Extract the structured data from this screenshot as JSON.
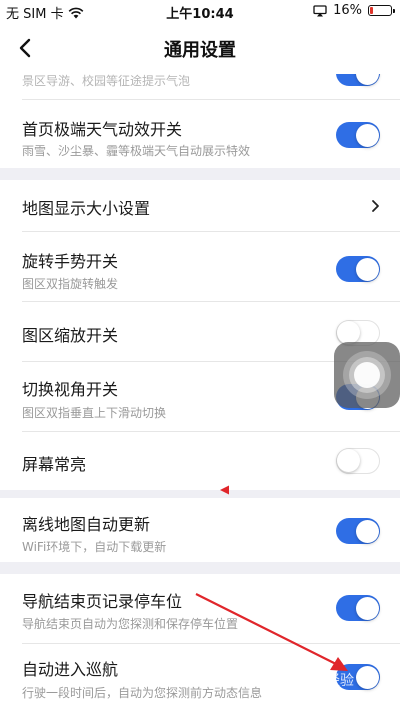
{
  "status_bar": {
    "carrier": "无 SIM 卡",
    "time": "上午10:44",
    "battery": "16%",
    "battery_level": 0.16,
    "icons": [
      "wifi-icon",
      "airplay-icon",
      "battery-icon"
    ]
  },
  "nav": {
    "title": "通用设置",
    "back_icon": "chevron-left-icon"
  },
  "settings": {
    "partial_top_sub": "景区导游、校园等征途提示气泡",
    "extreme_weather": {
      "title": "首页极端天气动效开关",
      "subtitle": "雨雪、沙尘暴、霾等极端天气自动展示特效",
      "on": true
    },
    "map_size": {
      "title": "地图显示大小设置",
      "chevron": "›"
    },
    "rotate_gesture": {
      "title": "旋转手势开关",
      "subtitle": "图区双指旋转触发",
      "on": true
    },
    "zoom_switch": {
      "title": "图区缩放开关",
      "on": false
    },
    "view_angle": {
      "title": "切换视角开关",
      "subtitle": "图区双指垂直上下滑动切换",
      "on": true
    },
    "screen_on": {
      "title": "屏幕常亮",
      "on": false
    },
    "offline_update": {
      "title": "离线地图自动更新",
      "subtitle": "WiFi环境下，自动下载更新",
      "on": true
    },
    "parking_record": {
      "title": "导航结束页记录停车位",
      "subtitle": "导航结束页自动为您探测和保存停车位置",
      "on": true
    },
    "auto_cruise": {
      "title": "自动进入巡航",
      "subtitle": "行驶一段时间后，自动为您探测前方动态信息",
      "on": true
    }
  },
  "colors": {
    "accent": "#2f6ee5",
    "annotation_red": "#e0262b",
    "background": "#efeff4"
  },
  "watermark": "经验"
}
